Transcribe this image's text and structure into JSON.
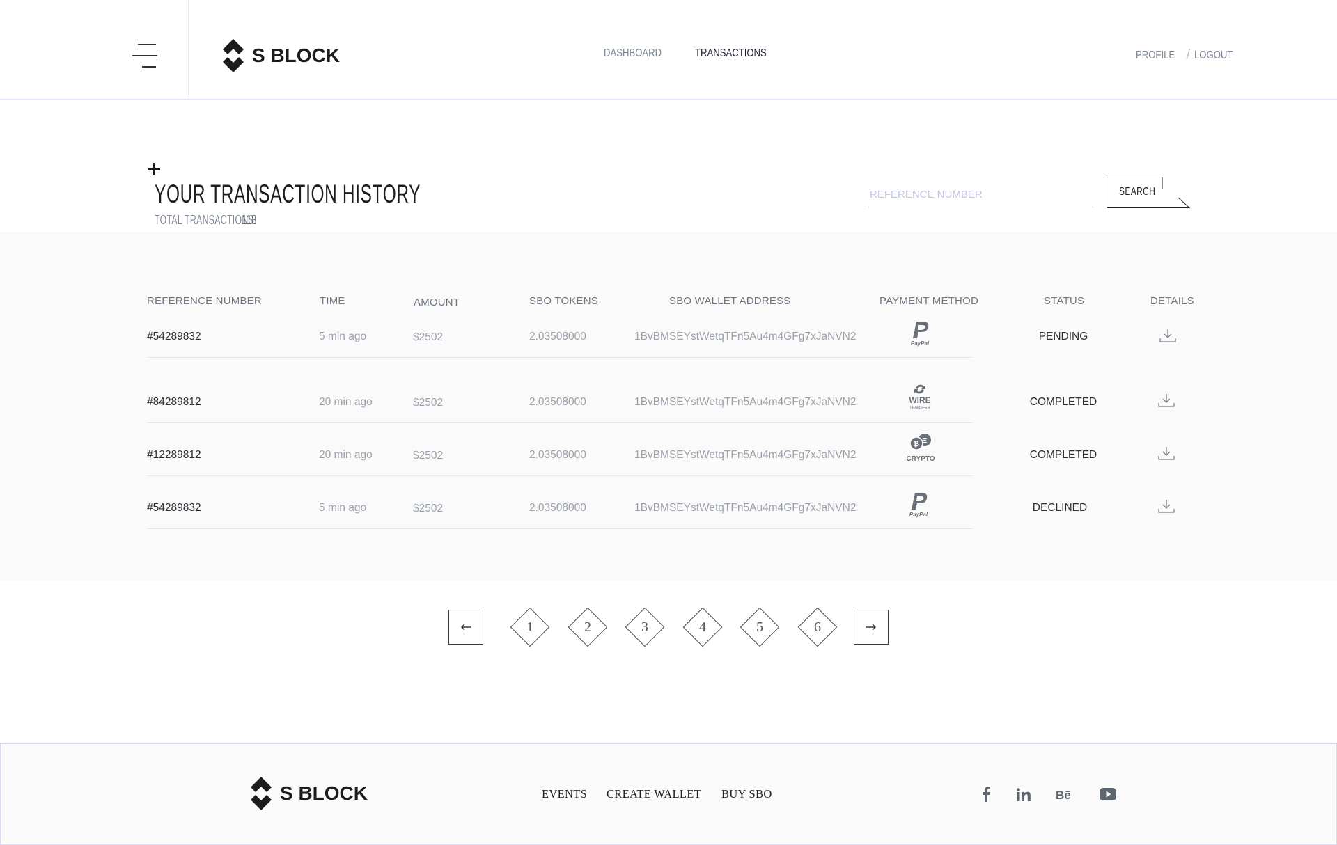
{
  "header": {
    "brand": "S BLOCK",
    "nav": [
      {
        "label": "DASHBOARD",
        "active": false
      },
      {
        "label": "TRANSACTIONS",
        "active": true
      }
    ],
    "user": {
      "profile": "PROFILE",
      "separator": "/",
      "logout": "LOGOUT"
    }
  },
  "page": {
    "title": "YOUR TRANSACTION HISTORY",
    "total_label": "TOTAL TRANSACTIONS:",
    "total_value": "118",
    "search": {
      "placeholder": "REFERENCE NUMBER",
      "button": "SEARCH"
    }
  },
  "table": {
    "columns": [
      "REFERENCE NUMBER",
      "TIME",
      "AMOUNT",
      "SBO TOKENS",
      "SBO WALLET ADDRESS",
      "PAYMENT METHOD",
      "STATUS",
      "DETAILS"
    ],
    "rows": [
      {
        "ref": "#54289832",
        "time": "5 min ago",
        "amount": "$2502",
        "tokens": "2.03508000",
        "wallet": "1BvBMSEYstWetqTFn5Au4m4GFg7xJaNVN2",
        "payment": "PayPal",
        "status": "PENDING"
      },
      {
        "ref": "#84289812",
        "time": "20 min ago",
        "amount": "$2502",
        "tokens": "2.03508000",
        "wallet": "1BvBMSEYstWetqTFn5Au4m4GFg7xJaNVN2",
        "payment": "WIRE",
        "payment_sub": "TRANSFER",
        "status": "COMPLETED"
      },
      {
        "ref": "#12289812",
        "time": "20 min ago",
        "amount": "$2502",
        "tokens": "2.03508000",
        "wallet": "1BvBMSEYstWetqTFn5Au4m4GFg7xJaNVN2",
        "payment": "CRYPTO",
        "status": "COMPLETED"
      },
      {
        "ref": "#54289832",
        "time": "5 min ago",
        "amount": "$2502",
        "tokens": "2.03508000",
        "wallet": "1BvBMSEYstWetqTFn5Au4m4GFg7xJaNVN2",
        "payment": "PayPal",
        "status": "DECLINED"
      }
    ],
    "details_icon": "download-icon"
  },
  "pagination": {
    "prev_icon": "arrow-left-icon",
    "next_icon": "arrow-right-icon",
    "pages": [
      "1",
      "2",
      "3",
      "4",
      "5",
      "6"
    ]
  },
  "footer": {
    "brand": "S BLOCK",
    "links": [
      "EVENTS",
      "CREATE WALLET",
      "BUY SBO"
    ],
    "social": [
      "facebook-icon",
      "linkedin-icon",
      "behance-icon",
      "youtube-icon"
    ]
  },
  "colors": {
    "accent_border": "#e3e1f3",
    "panel_bg": "#fafafa",
    "muted_text": "#9ba1ab"
  }
}
